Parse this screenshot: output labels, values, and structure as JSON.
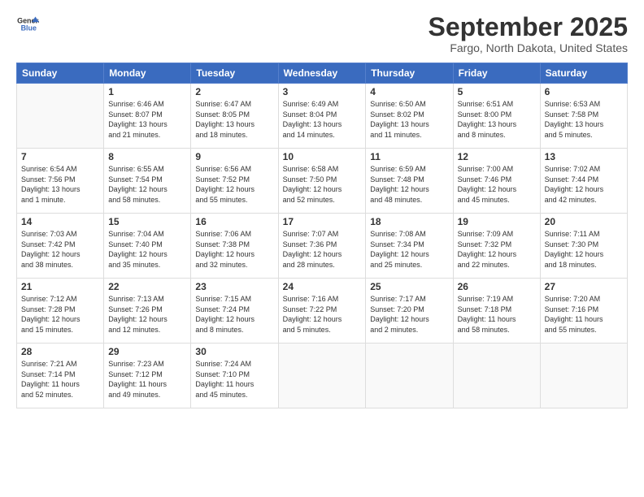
{
  "header": {
    "logo_line1": "General",
    "logo_line2": "Blue",
    "month_title": "September 2025",
    "location": "Fargo, North Dakota, United States"
  },
  "days_of_week": [
    "Sunday",
    "Monday",
    "Tuesday",
    "Wednesday",
    "Thursday",
    "Friday",
    "Saturday"
  ],
  "weeks": [
    [
      {
        "day": "",
        "info": ""
      },
      {
        "day": "1",
        "info": "Sunrise: 6:46 AM\nSunset: 8:07 PM\nDaylight: 13 hours\nand 21 minutes."
      },
      {
        "day": "2",
        "info": "Sunrise: 6:47 AM\nSunset: 8:05 PM\nDaylight: 13 hours\nand 18 minutes."
      },
      {
        "day": "3",
        "info": "Sunrise: 6:49 AM\nSunset: 8:04 PM\nDaylight: 13 hours\nand 14 minutes."
      },
      {
        "day": "4",
        "info": "Sunrise: 6:50 AM\nSunset: 8:02 PM\nDaylight: 13 hours\nand 11 minutes."
      },
      {
        "day": "5",
        "info": "Sunrise: 6:51 AM\nSunset: 8:00 PM\nDaylight: 13 hours\nand 8 minutes."
      },
      {
        "day": "6",
        "info": "Sunrise: 6:53 AM\nSunset: 7:58 PM\nDaylight: 13 hours\nand 5 minutes."
      }
    ],
    [
      {
        "day": "7",
        "info": "Sunrise: 6:54 AM\nSunset: 7:56 PM\nDaylight: 13 hours\nand 1 minute."
      },
      {
        "day": "8",
        "info": "Sunrise: 6:55 AM\nSunset: 7:54 PM\nDaylight: 12 hours\nand 58 minutes."
      },
      {
        "day": "9",
        "info": "Sunrise: 6:56 AM\nSunset: 7:52 PM\nDaylight: 12 hours\nand 55 minutes."
      },
      {
        "day": "10",
        "info": "Sunrise: 6:58 AM\nSunset: 7:50 PM\nDaylight: 12 hours\nand 52 minutes."
      },
      {
        "day": "11",
        "info": "Sunrise: 6:59 AM\nSunset: 7:48 PM\nDaylight: 12 hours\nand 48 minutes."
      },
      {
        "day": "12",
        "info": "Sunrise: 7:00 AM\nSunset: 7:46 PM\nDaylight: 12 hours\nand 45 minutes."
      },
      {
        "day": "13",
        "info": "Sunrise: 7:02 AM\nSunset: 7:44 PM\nDaylight: 12 hours\nand 42 minutes."
      }
    ],
    [
      {
        "day": "14",
        "info": "Sunrise: 7:03 AM\nSunset: 7:42 PM\nDaylight: 12 hours\nand 38 minutes."
      },
      {
        "day": "15",
        "info": "Sunrise: 7:04 AM\nSunset: 7:40 PM\nDaylight: 12 hours\nand 35 minutes."
      },
      {
        "day": "16",
        "info": "Sunrise: 7:06 AM\nSunset: 7:38 PM\nDaylight: 12 hours\nand 32 minutes."
      },
      {
        "day": "17",
        "info": "Sunrise: 7:07 AM\nSunset: 7:36 PM\nDaylight: 12 hours\nand 28 minutes."
      },
      {
        "day": "18",
        "info": "Sunrise: 7:08 AM\nSunset: 7:34 PM\nDaylight: 12 hours\nand 25 minutes."
      },
      {
        "day": "19",
        "info": "Sunrise: 7:09 AM\nSunset: 7:32 PM\nDaylight: 12 hours\nand 22 minutes."
      },
      {
        "day": "20",
        "info": "Sunrise: 7:11 AM\nSunset: 7:30 PM\nDaylight: 12 hours\nand 18 minutes."
      }
    ],
    [
      {
        "day": "21",
        "info": "Sunrise: 7:12 AM\nSunset: 7:28 PM\nDaylight: 12 hours\nand 15 minutes."
      },
      {
        "day": "22",
        "info": "Sunrise: 7:13 AM\nSunset: 7:26 PM\nDaylight: 12 hours\nand 12 minutes."
      },
      {
        "day": "23",
        "info": "Sunrise: 7:15 AM\nSunset: 7:24 PM\nDaylight: 12 hours\nand 8 minutes."
      },
      {
        "day": "24",
        "info": "Sunrise: 7:16 AM\nSunset: 7:22 PM\nDaylight: 12 hours\nand 5 minutes."
      },
      {
        "day": "25",
        "info": "Sunrise: 7:17 AM\nSunset: 7:20 PM\nDaylight: 12 hours\nand 2 minutes."
      },
      {
        "day": "26",
        "info": "Sunrise: 7:19 AM\nSunset: 7:18 PM\nDaylight: 11 hours\nand 58 minutes."
      },
      {
        "day": "27",
        "info": "Sunrise: 7:20 AM\nSunset: 7:16 PM\nDaylight: 11 hours\nand 55 minutes."
      }
    ],
    [
      {
        "day": "28",
        "info": "Sunrise: 7:21 AM\nSunset: 7:14 PM\nDaylight: 11 hours\nand 52 minutes."
      },
      {
        "day": "29",
        "info": "Sunrise: 7:23 AM\nSunset: 7:12 PM\nDaylight: 11 hours\nand 49 minutes."
      },
      {
        "day": "30",
        "info": "Sunrise: 7:24 AM\nSunset: 7:10 PM\nDaylight: 11 hours\nand 45 minutes."
      },
      {
        "day": "",
        "info": ""
      },
      {
        "day": "",
        "info": ""
      },
      {
        "day": "",
        "info": ""
      },
      {
        "day": "",
        "info": ""
      }
    ]
  ]
}
